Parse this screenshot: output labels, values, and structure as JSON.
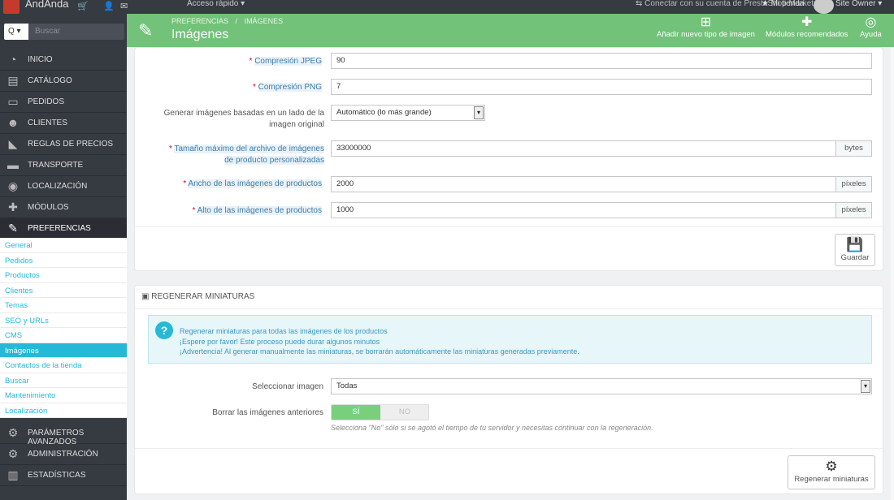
{
  "topbar": {
    "shop_name": "AndAnda",
    "icons": [
      "cart-icon",
      "user-icon",
      "envelope-icon"
    ],
    "quick_access": "Acceso rápido ▾",
    "marketplace": "⇆ Conectar con su cuenta de PrestaShop Marketplace",
    "my_store": "★ Mi tienda",
    "owner": "Site Owner ▾"
  },
  "sidebar": {
    "search_placeholder": "Buscar",
    "search_button": "Q ▾",
    "menu": [
      {
        "label": "Inicio",
        "icon": "dashboard-icon"
      },
      {
        "label": "Catálogo",
        "icon": "book-icon"
      },
      {
        "label": "Pedidos",
        "icon": "credit-card-icon"
      },
      {
        "label": "Clientes",
        "icon": "users-icon"
      },
      {
        "label": "Reglas de precios",
        "icon": "tag-icon"
      },
      {
        "label": "Transporte",
        "icon": "truck-icon"
      },
      {
        "label": "Localización",
        "icon": "globe-icon"
      },
      {
        "label": "Módulos",
        "icon": "puzzle-icon"
      },
      {
        "label": "Preferencias",
        "icon": "wrench-icon"
      }
    ],
    "submenu": [
      "General",
      "Pedidos",
      "Productos",
      "Clientes",
      "Temas",
      "SEO y URLs",
      "CMS",
      "Imágenes",
      "Contactos de la tienda",
      "Buscar",
      "Mantenimiento",
      "Localización"
    ],
    "bottom_menu": [
      {
        "label": "Parámetros avanzados",
        "icon": "cogs-icon"
      },
      {
        "label": "Administración",
        "icon": "cog-icon"
      },
      {
        "label": "Estadísticas",
        "icon": "bar-chart-icon"
      }
    ]
  },
  "header": {
    "breadcrumb_1": "PREFERENCIAS",
    "breadcrumb_sep": "/",
    "breadcrumb_2": "IMÁGENES",
    "title": "Imágenes",
    "btn_add": "Añadir nuevo tipo de imagen",
    "btn_modules": "Módulos recomendados",
    "btn_help": "Ayuda"
  },
  "form": {
    "jpeg_label": "Compresión JPEG",
    "jpeg_value": "90",
    "png_label": "Compresión PNG",
    "png_value": "7",
    "side_label_1": "Generar imágenes basadas en un lado de la",
    "side_label_2": "imagen original",
    "side_value": "Automático (lo más grande)",
    "maxsize_label_1": "Tamaño máximo del archivo de imágenes",
    "maxsize_label_2": "de producto personalizadas",
    "maxsize_value": "33000000",
    "maxsize_unit": "bytes",
    "width_label": "Ancho de las imágenes de productos",
    "width_value": "2000",
    "width_unit": "píxeles",
    "height_label": "Alto de las imágenes de productos",
    "height_value": "1000",
    "height_unit": "píxeles",
    "save_label": "Guardar"
  },
  "regen": {
    "title": "Regenerar miniaturas",
    "alert_1": "Regenerar miniaturas para todas las imágenes de los productos",
    "alert_2": "¡Espere por favor! Este proceso puede durar algunos minutos",
    "alert_3": "¡Advertencia! Al generar manualmente las miniaturas, se borrarán automáticamente las miniaturas generadas previamente.",
    "select_label": "Seleccionar imagen",
    "select_value": "Todas",
    "erase_label": "Borrar las imágenes anteriores",
    "yes": "SÍ",
    "no": "NO",
    "help": "Selecciona \"No\" sólo si se agotó el tiempo de tu servidor y necesitas continuar con la regeneración.",
    "button": "Regenerar miniaturas"
  }
}
